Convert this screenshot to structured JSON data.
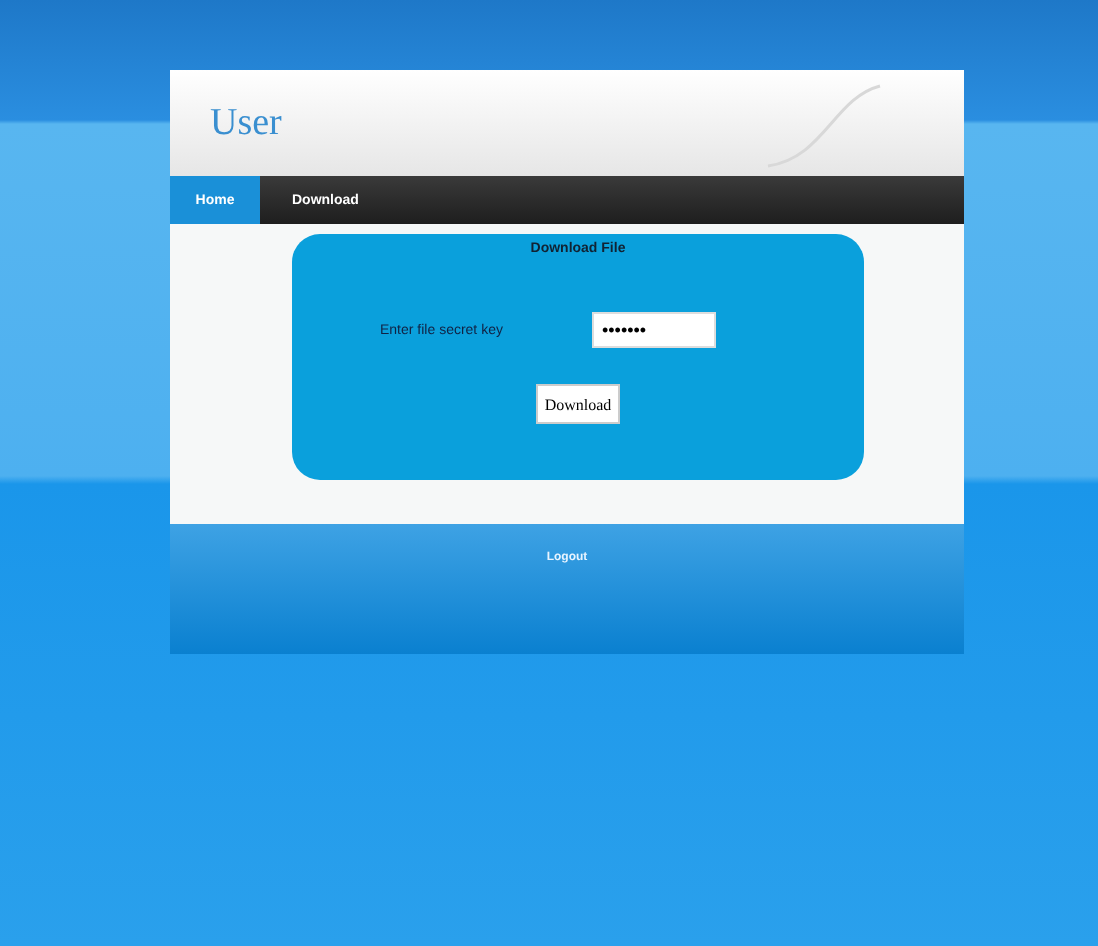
{
  "header": {
    "title": "User"
  },
  "nav": [
    {
      "label": "Home",
      "selected": true
    },
    {
      "label": "Download",
      "selected": false
    }
  ],
  "panel": {
    "title": "Download File",
    "field_label": "Enter file secret key",
    "field_value": "•••••••",
    "button": "Download"
  },
  "footer": {
    "text": "Logout"
  }
}
